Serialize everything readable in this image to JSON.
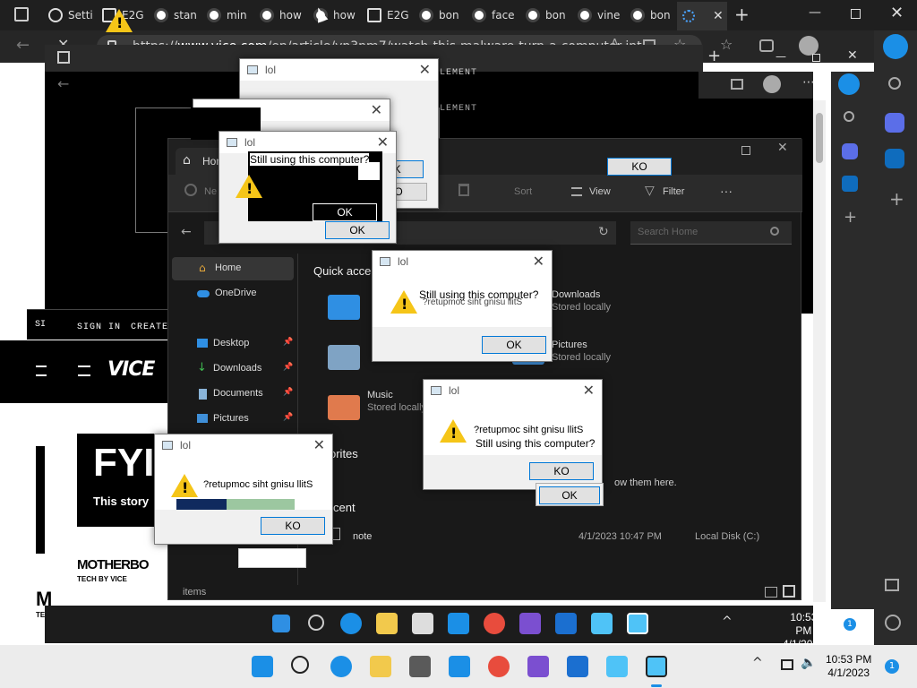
{
  "browser": {
    "tabs": [
      {
        "label": "Setti",
        "icon": "gear-icon"
      },
      {
        "label": "E2G",
        "icon": "document-icon"
      },
      {
        "label": "stan",
        "icon": "chrome-icon"
      },
      {
        "label": "min",
        "icon": "chrome-icon"
      },
      {
        "label": "how",
        "icon": "chrome-icon"
      },
      {
        "label": "how",
        "icon": "chrome-icon"
      },
      {
        "label": "E2G",
        "icon": "document-icon"
      },
      {
        "label": "bon",
        "icon": "chrome-icon"
      },
      {
        "label": "face",
        "icon": "chrome-icon"
      },
      {
        "label": "bon",
        "icon": "chrome-icon"
      },
      {
        "label": "vine",
        "icon": "chrome-icon"
      },
      {
        "label": "bon",
        "icon": "chrome-icon"
      }
    ],
    "url_prefix": "https://",
    "url_host": "www.vice.com",
    "url_path": "/en/article/yp3nm7/watch-this-malware-turn-a-computer-int..."
  },
  "vice_page": {
    "sign_in": "SIGN IN",
    "create": "CREATE",
    "logo": "VICE",
    "fyi": "FYI",
    "story": "This story",
    "motherboard": "MOTHERBO",
    "tech_by_vice": "TECH BY VICE",
    "frag_element": "ELEMENT",
    "frag_element2": "ELEMENT",
    "frag_si": "SI",
    "frag_m": "M",
    "frag_te": "TE"
  },
  "explorer": {
    "home_tab": "Hom",
    "toolbar": {
      "new": "Ne",
      "sort": "Sort",
      "view": "View",
      "filter": "Filter",
      "more": "···"
    },
    "search_placeholder": "Search Home",
    "nav": [
      {
        "label": "Home",
        "icon": "home-icon"
      },
      {
        "label": "OneDrive",
        "icon": "cloud-icon"
      },
      {
        "label": "Desktop",
        "icon": "desktop-icon"
      },
      {
        "label": "Downloads",
        "icon": "download-icon"
      },
      {
        "label": "Documents",
        "icon": "documents-icon"
      },
      {
        "label": "Pictures",
        "icon": "pictures-icon"
      }
    ],
    "quick_access": "Quick acce",
    "favorites": "orites",
    "recent": "cent",
    "items": [
      {
        "name": "Downloads",
        "sub": "Stored locally"
      },
      {
        "name": "Pictures",
        "sub": "Stored locally"
      },
      {
        "name": "Music",
        "sub": "Stored locally"
      }
    ],
    "show_them": "ow them here.",
    "recent_file": "note",
    "recent_date": "4/1/2023 10:47 PM",
    "recent_loc": "Local Disk (C:)",
    "status": "items"
  },
  "dialogs": {
    "title": "lol",
    "message": "Still using this computer?",
    "message_reversed": "?retupmoc siht gnisu llitS",
    "ok": "OK",
    "ok_reversed": "KO"
  },
  "taskbar": {
    "time": "10:53 PM",
    "date": "4/1/2023",
    "badge": "1"
  },
  "colors": {
    "accent": "#0078d7",
    "warning": "#f5c518",
    "edge": "#1b8fe6"
  }
}
